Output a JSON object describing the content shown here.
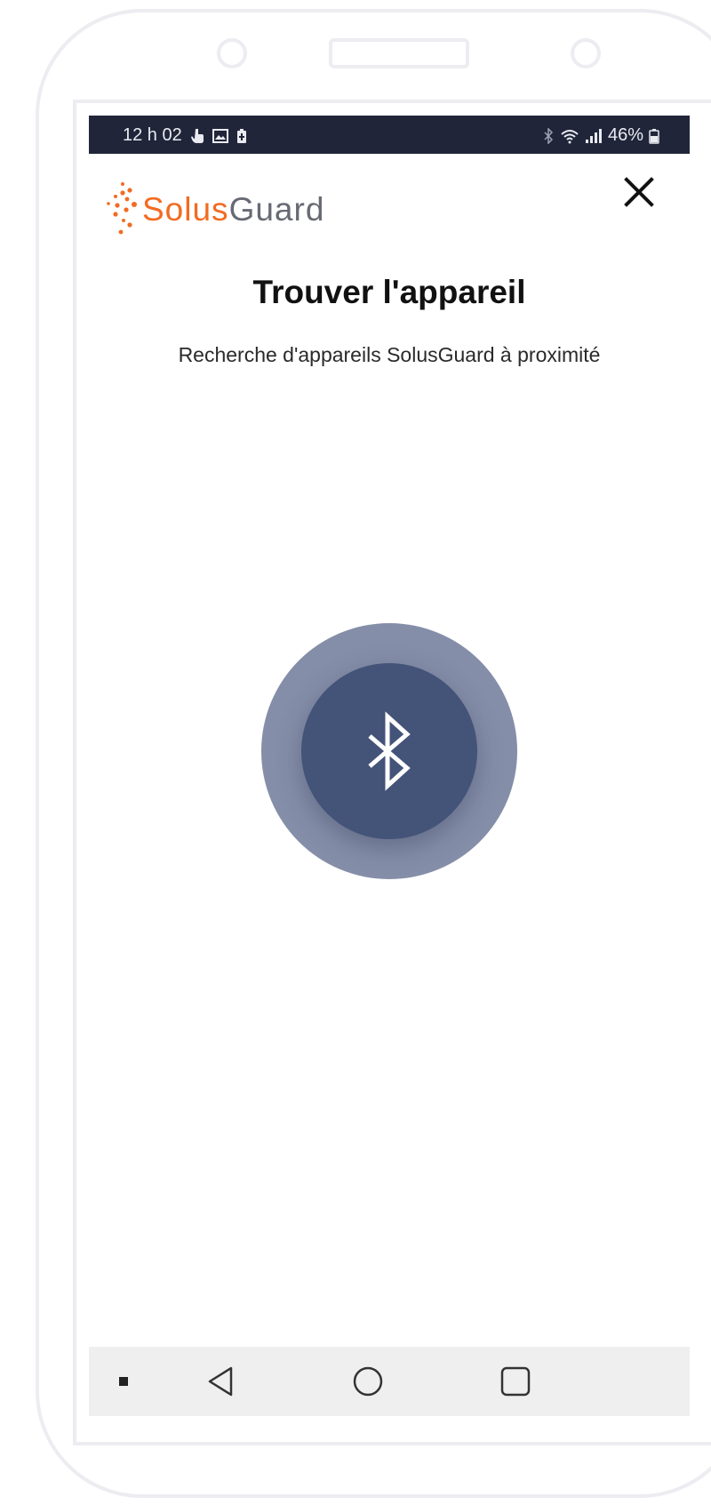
{
  "status_bar": {
    "time": "12 h 02",
    "battery_percent": "46%",
    "left_icons": [
      "touch-icon",
      "image-icon",
      "battery-saver-icon"
    ],
    "right_icons": [
      "bluetooth-icon",
      "wifi-icon",
      "signal-icon",
      "battery-icon"
    ]
  },
  "header": {
    "logo_part1": "Solus",
    "logo_part2": "Guard",
    "close_icon": "close-icon"
  },
  "main": {
    "title": "Trouver l'appareil",
    "subtitle": "Recherche d'appareils SolusGuard à proximité",
    "scan_icon": "bluetooth-icon"
  },
  "nav_bar": {
    "items": [
      "dot-icon",
      "back-icon",
      "home-icon",
      "recents-icon"
    ]
  },
  "colors": {
    "accent": "#f26b21",
    "status_bar": "#21253a",
    "bt_outer": "#858ea8",
    "bt_inner": "#445378"
  }
}
